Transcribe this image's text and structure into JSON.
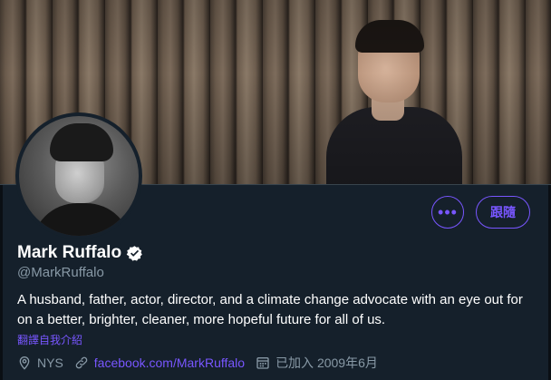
{
  "profile": {
    "display_name": "Mark Ruffalo",
    "handle": "@MarkRuffalo",
    "bio": "A husband, father, actor, director, and a climate change advocate with an eye out for on a better, brighter, cleaner, more hopeful future for all of us.",
    "translate_bio_label": "翻譯自我介紹",
    "location": "NYS",
    "website": "facebook.com/MarkRuffalo",
    "joined": "已加入 2009年6月"
  },
  "actions": {
    "more_label": "•••",
    "follow_label": "跟隨"
  },
  "icons": {
    "more": "more-icon",
    "verified": "verified-badge-icon",
    "location": "location-pin-icon",
    "website": "link-icon",
    "joined": "calendar-icon"
  },
  "colors": {
    "background": "#15202b",
    "accent": "#7856ff",
    "secondary_text": "#8899a6",
    "verified_badge": "#ffffff"
  }
}
